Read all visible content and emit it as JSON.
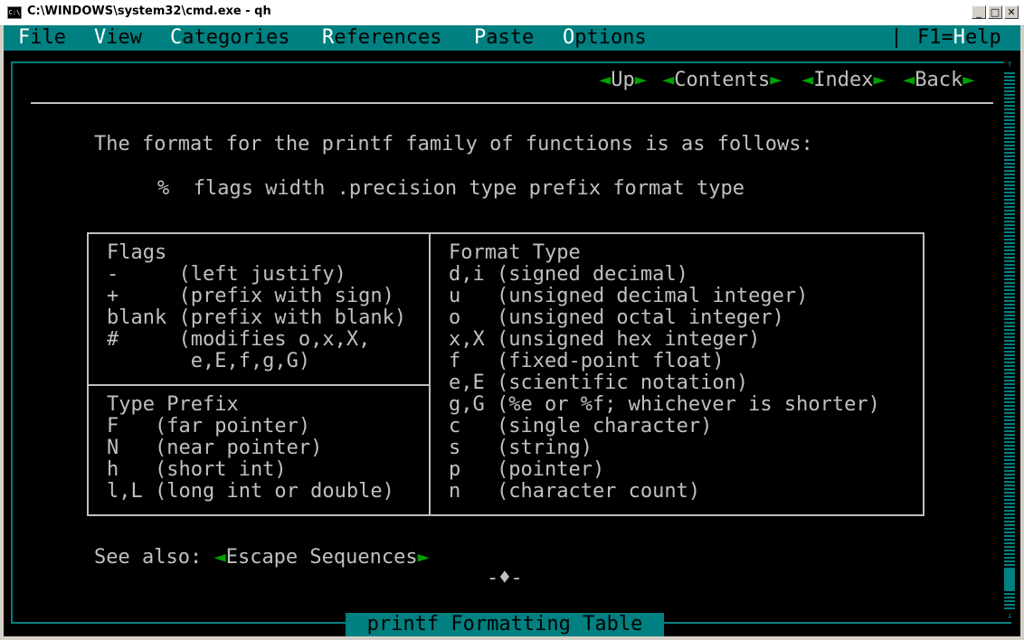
{
  "window": {
    "title": "C:\\WINDOWS\\system32\\cmd.exe - qh",
    "icon_text": "C:\\",
    "minimize": "_",
    "maximize": "□",
    "close": "✕"
  },
  "menu": {
    "file": {
      "hot": "F",
      "rest": "ile"
    },
    "view": {
      "hot": "V",
      "rest": "iew"
    },
    "categories": {
      "hot": "C",
      "rest": "ategories"
    },
    "references": {
      "hot": "R",
      "rest": "eferences"
    },
    "paste": {
      "hot": "P",
      "rest": "aste"
    },
    "options": {
      "hot": "O",
      "rest": "ptions"
    },
    "help": {
      "pre": "F1=",
      "hot": "H",
      "rest": "elp"
    }
  },
  "nav": {
    "arrow_left": "◄",
    "arrow_right": "►",
    "up": "Up",
    "contents": "Contents",
    "index": "Index",
    "back": "Back"
  },
  "content": {
    "intro": "The format for the printf family of functions is as follows:",
    "syntax": "%  flags width .precision type prefix format type",
    "flags_title": "Flags",
    "flags": [
      "-     (left justify)",
      "+     (prefix with sign)",
      "blank (prefix with blank)",
      "#     (modifies o,x,X,",
      "       e,E,f,g,G)"
    ],
    "prefix_title": "Type Prefix",
    "prefixes": [
      "F   (far pointer)",
      "N   (near pointer)",
      "h   (short int)",
      "l,L (long int or double)"
    ],
    "format_title": "Format Type",
    "formats": [
      "d,i (signed decimal)",
      "u   (unsigned decimal integer)",
      "o   (unsigned octal integer)",
      "x,X (unsigned hex integer)",
      "f   (fixed-point float)",
      "e,E (scientific notation)",
      "g,G (%e or %f; whichever is shorter)",
      "c   (single character)",
      "s   (string)",
      "p   (pointer)",
      "n   (character count)"
    ],
    "see_also": "See also: ",
    "see_also_link": "Escape Sequences",
    "end_marker": "-♦-"
  },
  "status": {
    "topic": "printf Formatting Table"
  },
  "colors": {
    "teal": "#008080",
    "text": "#c0c0c0",
    "hotkey": "#ffffff",
    "link_arrow": "#00a000",
    "background": "#000000"
  }
}
